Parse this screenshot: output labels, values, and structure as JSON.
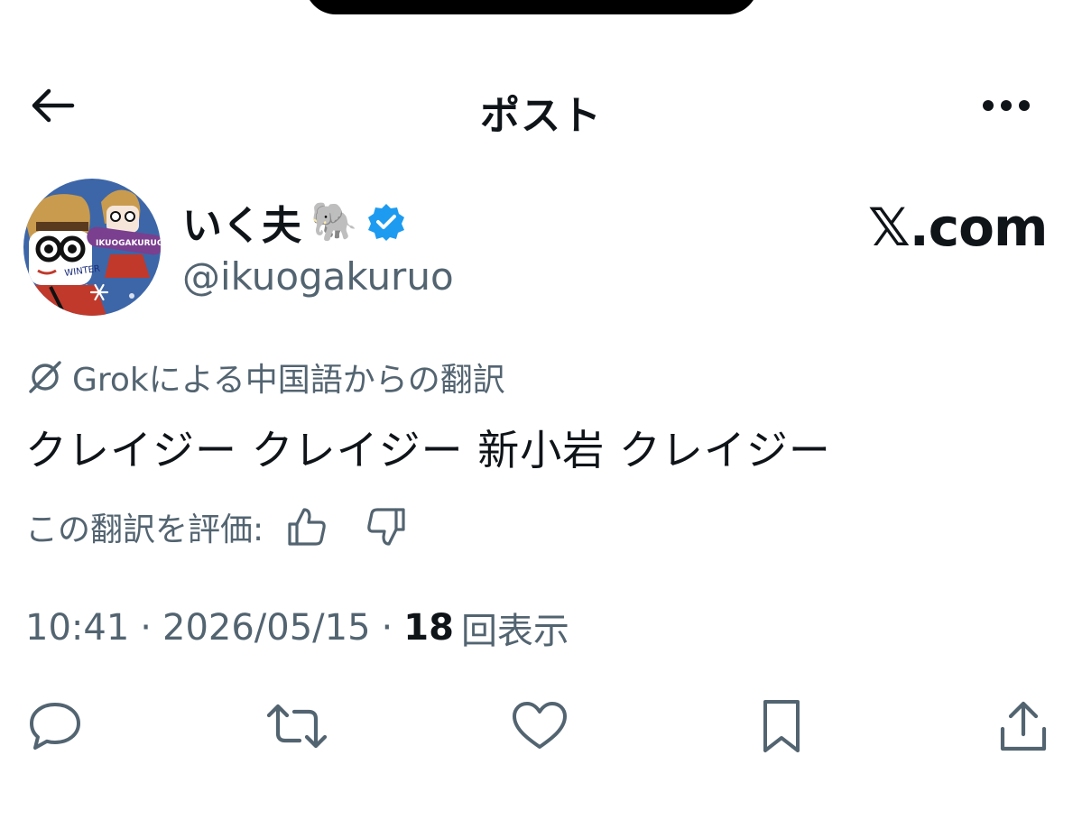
{
  "header": {
    "title": "ポスト",
    "back_icon": "arrow-left-icon",
    "more_icon": "more-horizontal-icon"
  },
  "author": {
    "display_name": "いく夫",
    "name_emoji": "🐘",
    "verified_icon": "verified-badge-icon",
    "verified_color": "#1d9bf0",
    "handle": "@ikuogakuruo",
    "avatar_text_badge": "IKUOGAKURUO",
    "avatar_text_winter": "WINTER"
  },
  "watermark": {
    "logo": "𝕏",
    "text": ".com"
  },
  "translation": {
    "icon": "grok-icon",
    "note": "Grokによる中国語からの翻訳"
  },
  "tweet": {
    "text": "クレイジー クレイジー 新小岩 クレイジー"
  },
  "rating": {
    "label": "この翻訳を評価:",
    "thumbs_up_icon": "thumbs-up-icon",
    "thumbs_down_icon": "thumbs-down-icon"
  },
  "meta": {
    "time": "10:41",
    "separator": "·",
    "date": "2026/05/15",
    "views_count": "18",
    "views_label": "回表示"
  },
  "actions": {
    "reply_icon": "reply-icon",
    "repost_icon": "repost-icon",
    "like_icon": "heart-icon",
    "bookmark_icon": "bookmark-icon",
    "share_icon": "share-icon"
  },
  "colors": {
    "text_primary": "#0f1419",
    "text_secondary": "#536471",
    "accent": "#1d9bf0"
  }
}
